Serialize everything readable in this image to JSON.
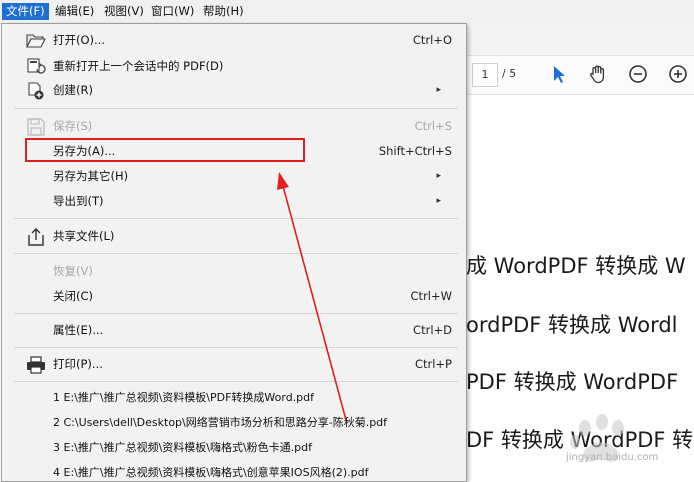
{
  "menubar": {
    "items": [
      {
        "label": "文件(F)",
        "active": true
      },
      {
        "label": "编辑(E)"
      },
      {
        "label": "视图(V)"
      },
      {
        "label": "窗口(W)"
      },
      {
        "label": "帮助(H)"
      }
    ]
  },
  "toolbar": {
    "page_current": "1",
    "page_total": "/ 5"
  },
  "document": {
    "lines": [
      "成 WordPDF 转换成 W",
      "ordPDF 转换成 Wordl",
      "PDF 转换成 WordPDF",
      "DF 转换成 WordPDF 转"
    ]
  },
  "filemenu": {
    "open": {
      "label": "打开(O)...",
      "shortcut": "Ctrl+O",
      "icon": "folder-open-icon"
    },
    "reopen": {
      "label": "重新打开上一个会话中的 PDF(D)",
      "icon": "reopen-session-icon"
    },
    "create": {
      "label": "创建(R)",
      "icon": "create-pdf-icon"
    },
    "save": {
      "label": "保存(S)",
      "shortcut": "Ctrl+S",
      "icon": "save-icon"
    },
    "saveas": {
      "label": "另存为(A)...",
      "shortcut": "Shift+Ctrl+S"
    },
    "saveother": {
      "label": "另存为其它(H)"
    },
    "export": {
      "label": "导出到(T)"
    },
    "share": {
      "label": "共享文件(L)",
      "icon": "share-icon"
    },
    "revert": {
      "label": "恢复(V)"
    },
    "close": {
      "label": "关闭(C)",
      "shortcut": "Ctrl+W"
    },
    "properties": {
      "label": "属性(E)...",
      "shortcut": "Ctrl+D"
    },
    "print": {
      "label": "打印(P)...",
      "shortcut": "Ctrl+P",
      "icon": "printer-icon"
    },
    "recent": [
      "1 E:\\推广\\推广总视频\\资料模板\\PDF转换成Word.pdf",
      "2 C:\\Users\\dell\\Desktop\\网络营销市场分析和思路分享-陈秋菊.pdf",
      "3 E:\\推广\\推广总视频\\资料模板\\嗨格式\\粉色卡通.pdf",
      "4 E:\\推广\\推广总视频\\资料模板\\嗨格式\\创意苹果IOS风格(2).pdf"
    ]
  },
  "watermark": {
    "text": "jingyan.baidu.com"
  },
  "colors": {
    "highlight": "#e02020",
    "menu_active": "#1f6fd0",
    "tool_accent": "#1f6fd0"
  }
}
